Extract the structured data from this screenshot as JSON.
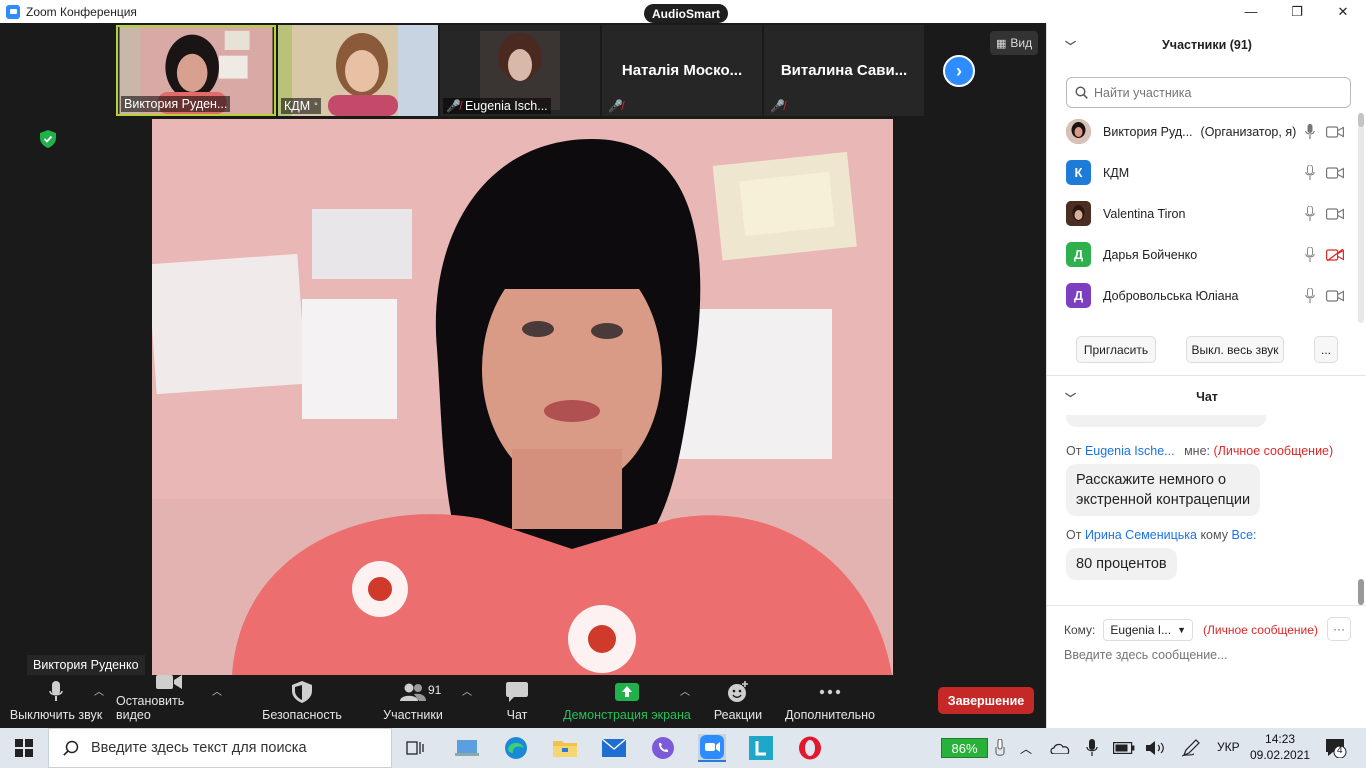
{
  "window": {
    "title": "Zoom Конференция",
    "badge": "AudioSmart",
    "minimize": "—",
    "maximize": "❐",
    "close": "✕"
  },
  "thumbnails": [
    {
      "name": "Виктория Руденко",
      "display_name": "Виктория Руден...",
      "active": true,
      "muted": false
    },
    {
      "name": "КДМ",
      "display_name": "КДМ",
      "active": false,
      "muted": false
    },
    {
      "name": "Eugenia Ischenko",
      "display_name": "Eugenia Isch...",
      "active": false,
      "muted": true
    },
    {
      "name": "Наталія Москова",
      "display_name": "Наталія Моско...",
      "active": false,
      "muted": true,
      "video_off": true
    },
    {
      "name": "Виталина Савина",
      "display_name": "Виталина Сави...",
      "active": false,
      "muted": true,
      "video_off": true
    }
  ],
  "view_button": "Вид",
  "speaker": {
    "name": "Виктория Руденко"
  },
  "toolbar": {
    "mute": "Выключить звук",
    "stop_video": "Остановить видео",
    "security": "Безопасность",
    "participants": "Участники",
    "participants_count": "91",
    "chat": "Чат",
    "share": "Демонстрация экрана",
    "reactions": "Реакции",
    "more": "Дополнительно",
    "end": "Завершение"
  },
  "participants_panel": {
    "title": "Участники (91)",
    "search_placeholder": "Найти участника",
    "people": [
      {
        "name": "Виктория Руд...",
        "role": "(Организатор, я)",
        "avatar_letter": "",
        "avatar_color": "#7a5b52",
        "video_off": false
      },
      {
        "name": "КДМ",
        "role": "",
        "avatar_letter": "К",
        "avatar_color": "#1f7bd8",
        "video_off": false
      },
      {
        "name": "Valentina Tiron",
        "role": "",
        "avatar_letter": "",
        "avatar_color": "#5a3a2a",
        "video_off": false
      },
      {
        "name": "Дарья Бойченко",
        "role": "",
        "avatar_letter": "Д",
        "avatar_color": "#2eb04c",
        "video_off": true
      },
      {
        "name": "Добровольська Юліана",
        "role": "",
        "avatar_letter": "Д",
        "avatar_color": "#7b3fc0",
        "video_off": false
      }
    ],
    "invite": "Пригласить",
    "mute_all": "Выкл. весь звук",
    "more": "..."
  },
  "chat_panel": {
    "title": "Чат",
    "messages": [
      {
        "from_prefix": "От",
        "from": "Eugenia Ische...",
        "to": "мне:",
        "tag": "(Личное сообщение)",
        "text_line1": "Расскажите немного о",
        "text_line2": "экстренной контрацепции"
      },
      {
        "from_prefix": "От",
        "from": "Ирина Семеницька",
        "to_prefix": "кому",
        "to": "Все:",
        "text": "80 процентов"
      }
    ],
    "to_label": "Кому:",
    "to_value": "Eugenia I...",
    "to_tag": "(Личное сообщение)",
    "input_placeholder": "Введите здесь сообщение..."
  },
  "taskbar": {
    "search_placeholder": "Введите здесь текст для поиска",
    "battery": "86%",
    "language": "УКР",
    "time": "14:23",
    "date": "09.02.2021",
    "notifications": "4"
  },
  "colors": {
    "zoom_blue": "#2d8cff",
    "end_red": "#c62828",
    "share_green": "#21b14b",
    "active_border": "#b4d334"
  }
}
